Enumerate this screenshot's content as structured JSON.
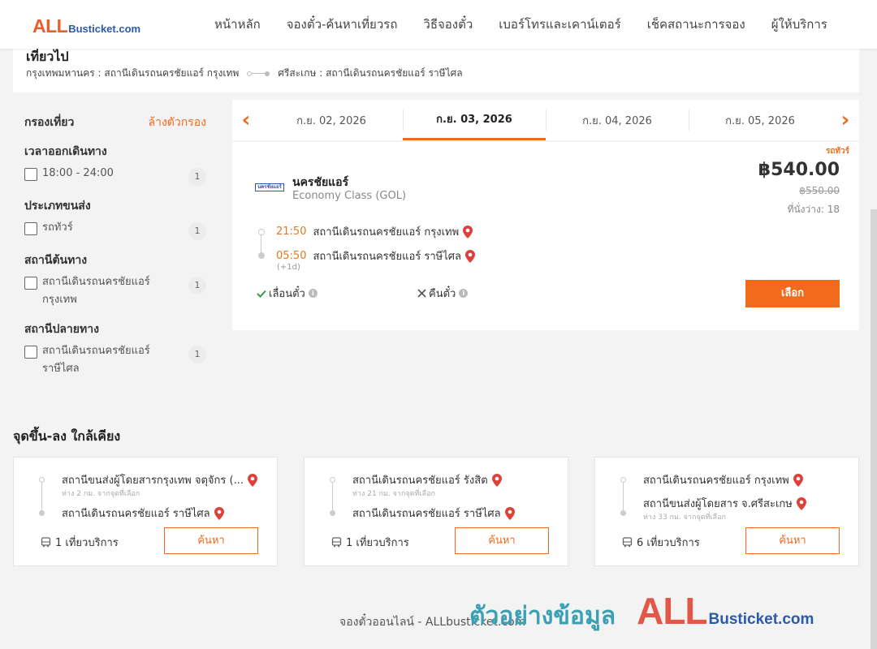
{
  "brand": {
    "all": "ALL",
    "bus": "Busticket.com"
  },
  "nav": [
    "หน้าหลัก",
    "จองตั๋ว-ค้นหาเที่ยวรถ",
    "วิธีจองตั๋ว",
    "เบอร์โทรและเคาน์เตอร์",
    "เช็คสถานะการจอง",
    "ผู้ให้บริการ"
  ],
  "trip": {
    "title": "เที่ยวไป",
    "from": "กรุงเทพมหานคร : สถานีเดินรถนครชัยแอร์ กรุงเทพ",
    "to": "ศรีสะเกษ : สถานีเดินรถนครชัยแอร์ ราษีไศล"
  },
  "filter": {
    "title": "กรองเที่ยว",
    "clear": "ล้างตัวกรอง",
    "groups": [
      {
        "title": "เวลาออกเดินทาง",
        "items": [
          {
            "label": "18:00 - 24:00",
            "count": "1"
          }
        ]
      },
      {
        "title": "ประเภทขนส่ง",
        "items": [
          {
            "label": "รถทัวร์",
            "count": "1"
          }
        ]
      },
      {
        "title": "สถานีต้นทาง",
        "items": [
          {
            "label": "สถานีเดินรถนครชัยแอร์ กรุงเทพ",
            "count": "1"
          }
        ]
      },
      {
        "title": "สถานีปลายทาง",
        "items": [
          {
            "label": "สถานีเดินรถนครชัยแอร์ ราษีไศล",
            "count": "1"
          }
        ]
      }
    ]
  },
  "dates": [
    "ก.ย. 02, 2026",
    "ก.ย. 03, 2026",
    "ก.ย. 04, 2026",
    "ก.ย. 05, 2026"
  ],
  "active_date_index": 1,
  "result": {
    "badge": "รถทัวร์",
    "operator": "นครชัยแอร์",
    "operator_logo": "นครชัยแอร์",
    "class": "Economy Class (GOL)",
    "price": "฿540.00",
    "old_price": "฿550.00",
    "seats": "ที่นั่งว่าง: 18",
    "depart_time": "21:50",
    "depart_station": "สถานีเดินรถนครชัยแอร์ กรุงเทพ",
    "arrive_time": "05:50",
    "arrive_station": "สถานีเดินรถนครชัยแอร์ ราษีไศล",
    "next_day": "(+1d)",
    "reschedule": "เลื่อนตั๋ว",
    "refund": "คืนตั๋ว",
    "select": "เลือก"
  },
  "nearby": {
    "title": "จุดขึ้น-ลง ใกล้เคียง",
    "cards": [
      {
        "from": "สถานีขนส่งผู้โดยสารกรุงเทพ จตุจักร (...",
        "from_dist": "ห่าง 2 กม. จากจุดที่เลือก",
        "to": "สถานีเดินรถนครชัยแอร์ ราษีไศล",
        "to_dist": "",
        "trips": "1 เที่ยวบริการ",
        "button": "ค้นหา"
      },
      {
        "from": "สถานีเดินรถนครชัยแอร์ รังสิต",
        "from_dist": "ห่าง 21 กม. จากจุดที่เลือก",
        "to": "สถานีเดินรถนครชัยแอร์ ราษีไศล",
        "to_dist": "",
        "trips": "1 เที่ยวบริการ",
        "button": "ค้นหา"
      },
      {
        "from": "สถานีเดินรถนครชัยแอร์ กรุงเทพ",
        "from_dist": "",
        "to": "สถานีขนส่งผู้โดยสาร จ.ศรีสะเกษ",
        "to_dist": "ห่าง 33 กม. จากจุดที่เลือก",
        "trips": "6 เที่ยวบริการ",
        "button": "ค้นหา"
      }
    ]
  },
  "footer": "จองตั๋วออนไลน์ - ALLbusticket.com",
  "watermark": {
    "thai": "ตัวอย่างข้อมูล",
    "all": "ALL",
    "bus": "Busticket.com"
  },
  "colors": {
    "accent": "#f26a1b",
    "brand_red": "#ec5d2a",
    "brand_blue": "#2a5aa8",
    "pin": "#e0403a",
    "watermark_teal": "#3aa0b4"
  },
  "icons": {
    "prev": "chevron-left-icon",
    "next": "chevron-right-icon",
    "pin": "map-pin-icon",
    "check": "check-icon",
    "cross": "cross-icon",
    "info": "info-icon",
    "bus": "bus-icon"
  }
}
